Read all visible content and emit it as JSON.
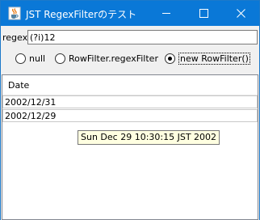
{
  "window": {
    "title": "JST RegexFilterのテスト",
    "app_icon": "java-coffee-cup-icon",
    "controls": [
      "minimize-icon",
      "maximize-icon",
      "close-icon"
    ]
  },
  "filter": {
    "label": "regex:",
    "value": "(?i)12"
  },
  "radios": [
    {
      "label": "null",
      "selected": false
    },
    {
      "label": "RowFilter.regexFilter",
      "selected": false
    },
    {
      "label": "new RowFilter()",
      "selected": true
    }
  ],
  "table": {
    "columns": [
      "Date"
    ],
    "rows": [
      [
        "2002/12/31"
      ],
      [
        "2002/12/29"
      ]
    ]
  },
  "tooltip": {
    "text": "Sun Dec 29 10:30:15 JST 2002"
  },
  "colors": {
    "titlebar": "#0a78d7",
    "tooltip_bg": "#ffffe1",
    "window_bg": "#f0f0f0"
  }
}
